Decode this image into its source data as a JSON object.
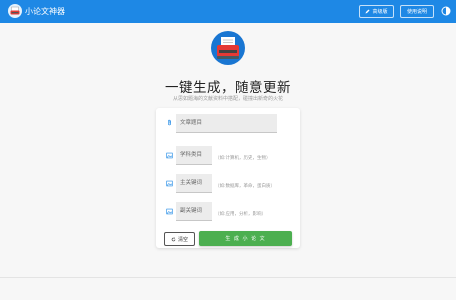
{
  "header": {
    "brand_icon": "typewriter-icon",
    "title": "小论文神器",
    "advanced_label": "高级版",
    "help_label": "使用说明",
    "theme_icon": "theme-toggle-icon",
    "bg_color": "#1e88e5"
  },
  "hero": {
    "logo_icon": "typewriter-logo",
    "headline": "一键生成，随意更新",
    "subtitle": "从思如题海的文献资料中搭配，碰撞出新奇的火花"
  },
  "form": {
    "title_field": {
      "placeholder": "文章题目",
      "icon": "paperclip-icon"
    },
    "subject_field": {
      "placeholder": "学科类目",
      "icon": "image-icon",
      "hint": "（如:计算机，历史，生物）"
    },
    "main_keyword_field": {
      "placeholder": "主关键词",
      "icon": "image-icon",
      "hint": "（如:数据库，革命，蛋白质）"
    },
    "sub_keyword_field": {
      "placeholder": "副关键词",
      "icon": "image-icon",
      "hint": "（如:应用，分析，影响）"
    }
  },
  "actions": {
    "clear_label": "清空",
    "clear_icon": "refresh-icon",
    "generate_label": "生 成 小 论 文",
    "generate_color": "#4caf50"
  }
}
